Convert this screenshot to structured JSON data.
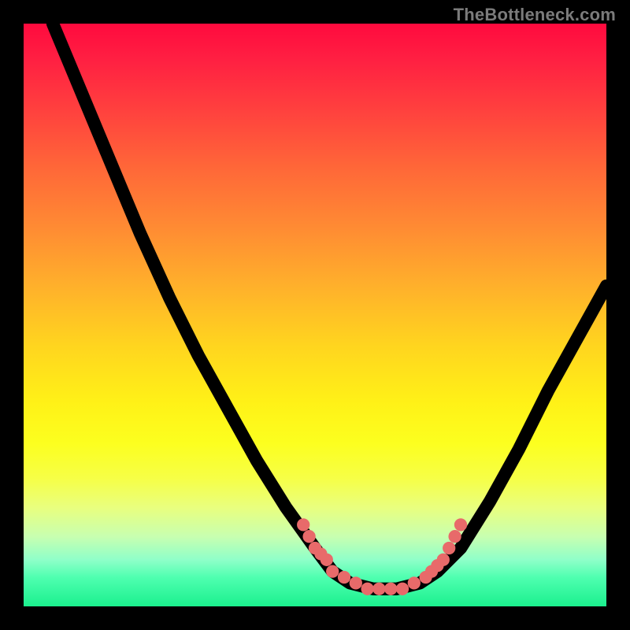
{
  "watermark": "TheBottleneck.com",
  "chart_data": {
    "type": "line",
    "title": "",
    "xlabel": "",
    "ylabel": "",
    "xlim": [
      0,
      100
    ],
    "ylim": [
      0,
      100
    ],
    "grid": false,
    "legend": false,
    "curve": [
      {
        "x": 5,
        "y": 100
      },
      {
        "x": 10,
        "y": 88
      },
      {
        "x": 15,
        "y": 76
      },
      {
        "x": 20,
        "y": 64
      },
      {
        "x": 25,
        "y": 53
      },
      {
        "x": 30,
        "y": 43
      },
      {
        "x": 35,
        "y": 34
      },
      {
        "x": 40,
        "y": 25
      },
      {
        "x": 45,
        "y": 17
      },
      {
        "x": 50,
        "y": 10
      },
      {
        "x": 53,
        "y": 6
      },
      {
        "x": 56,
        "y": 4
      },
      {
        "x": 60,
        "y": 3
      },
      {
        "x": 64,
        "y": 3
      },
      {
        "x": 68,
        "y": 4
      },
      {
        "x": 71,
        "y": 6
      },
      {
        "x": 75,
        "y": 10
      },
      {
        "x": 80,
        "y": 18
      },
      {
        "x": 85,
        "y": 27
      },
      {
        "x": 90,
        "y": 37
      },
      {
        "x": 95,
        "y": 46
      },
      {
        "x": 100,
        "y": 55
      }
    ],
    "markers": [
      {
        "x": 48,
        "y": 14
      },
      {
        "x": 49,
        "y": 12
      },
      {
        "x": 50,
        "y": 10
      },
      {
        "x": 51,
        "y": 9
      },
      {
        "x": 52,
        "y": 8
      },
      {
        "x": 53,
        "y": 6
      },
      {
        "x": 55,
        "y": 5
      },
      {
        "x": 57,
        "y": 4
      },
      {
        "x": 59,
        "y": 3
      },
      {
        "x": 61,
        "y": 3
      },
      {
        "x": 63,
        "y": 3
      },
      {
        "x": 65,
        "y": 3
      },
      {
        "x": 67,
        "y": 4
      },
      {
        "x": 69,
        "y": 5
      },
      {
        "x": 70,
        "y": 6
      },
      {
        "x": 71,
        "y": 7
      },
      {
        "x": 72,
        "y": 8
      },
      {
        "x": 73,
        "y": 10
      },
      {
        "x": 74,
        "y": 12
      },
      {
        "x": 75,
        "y": 14
      }
    ],
    "background_gradient": {
      "top": "#ff0a3e",
      "middle": "#ffd41f",
      "bottom": "#1bf08e"
    }
  }
}
